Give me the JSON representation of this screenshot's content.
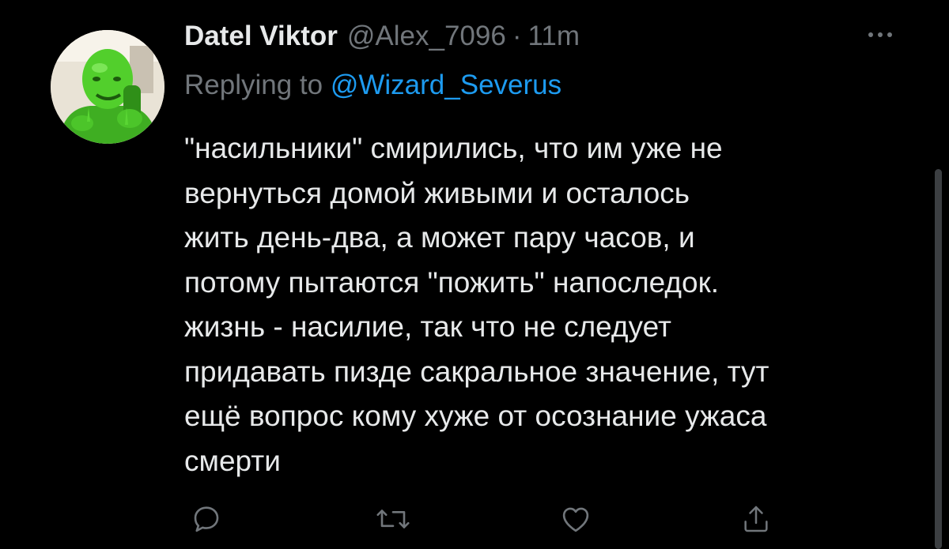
{
  "tweet": {
    "display_name": "Datel Viktor",
    "handle": "@Alex_7096",
    "separator": "·",
    "time": "11m",
    "reply_prefix": "Replying to",
    "reply_to": "@Wizard_Severus",
    "body_lines": [
      "\"насильники\" смирились, что им уже не",
      "вернуться домой живыми и  осталось",
      "жить день-два, а может пару часов, и",
      "потому пытаются \"пожить\" напоследок.",
      "жизнь - насилие, так что не следует",
      "придавать пизде сакральное значение, тут",
      "ещё вопрос кому хуже от осознание ужаса",
      "смерти"
    ]
  },
  "actions": [
    {
      "name": "reply",
      "icon": "reply-bubble-icon"
    },
    {
      "name": "retweet",
      "icon": "retweet-icon"
    },
    {
      "name": "like",
      "icon": "heart-icon"
    },
    {
      "name": "share",
      "icon": "share-icon"
    }
  ],
  "colors": {
    "background": "#000000",
    "text_primary": "#e7e9ea",
    "text_secondary": "#71767b",
    "accent": "#1d9bf0",
    "avatar_green": "#49c928"
  }
}
